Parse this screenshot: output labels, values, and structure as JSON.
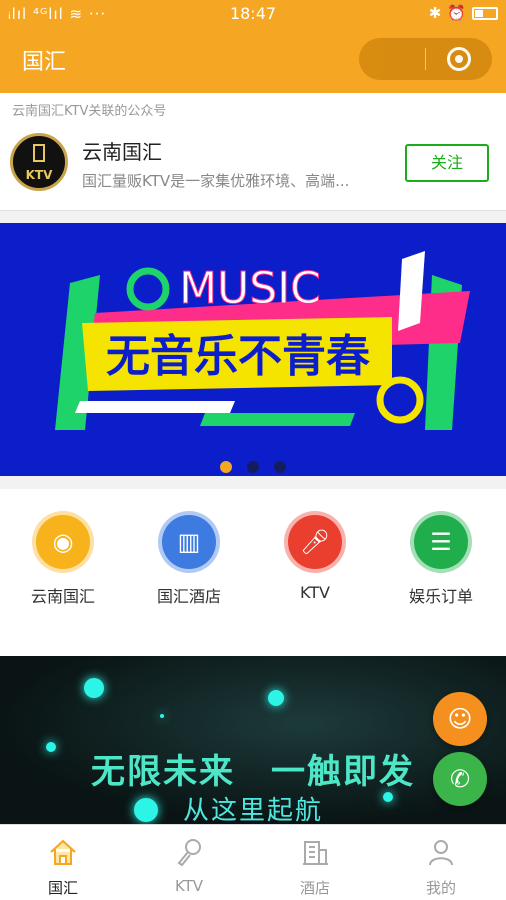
{
  "status": {
    "signals": "ᵢlıl ⁴ᴳlıl ≋ ···",
    "time": "18:47"
  },
  "header": {
    "title": "国汇",
    "accent": "#f5a623"
  },
  "official_account": {
    "hint": "云南国汇KTV关联的公众号",
    "logo_text": "KTV",
    "name": "云南国汇",
    "description": "国汇量贩KTV是一家集优雅环境、高端...",
    "follow_label": "关注"
  },
  "banner": {
    "word": "MUSIC",
    "slogan": "无音乐不青春",
    "slide_count": 3,
    "active_slide": 1
  },
  "nav": [
    {
      "label": "云南国汇",
      "icon": "music-disc-icon",
      "color": "#f7b21c"
    },
    {
      "label": "国汇酒店",
      "icon": "building-icon",
      "color": "#3d7be0"
    },
    {
      "label": "KTV",
      "icon": "microphone-icon",
      "color": "#ea3f2f"
    },
    {
      "label": "娱乐订单",
      "icon": "clipboard-icon",
      "color": "#1fae4b"
    }
  ],
  "promo": {
    "line1": "无限未来　一触即发",
    "line2": "从这里起航"
  },
  "tabs": [
    {
      "label": "国汇",
      "icon": "home-icon",
      "active": true
    },
    {
      "label": "KTV",
      "icon": "microphone-icon",
      "active": false
    },
    {
      "label": "酒店",
      "icon": "building-icon",
      "active": false
    },
    {
      "label": "我的",
      "icon": "user-icon",
      "active": false
    }
  ]
}
